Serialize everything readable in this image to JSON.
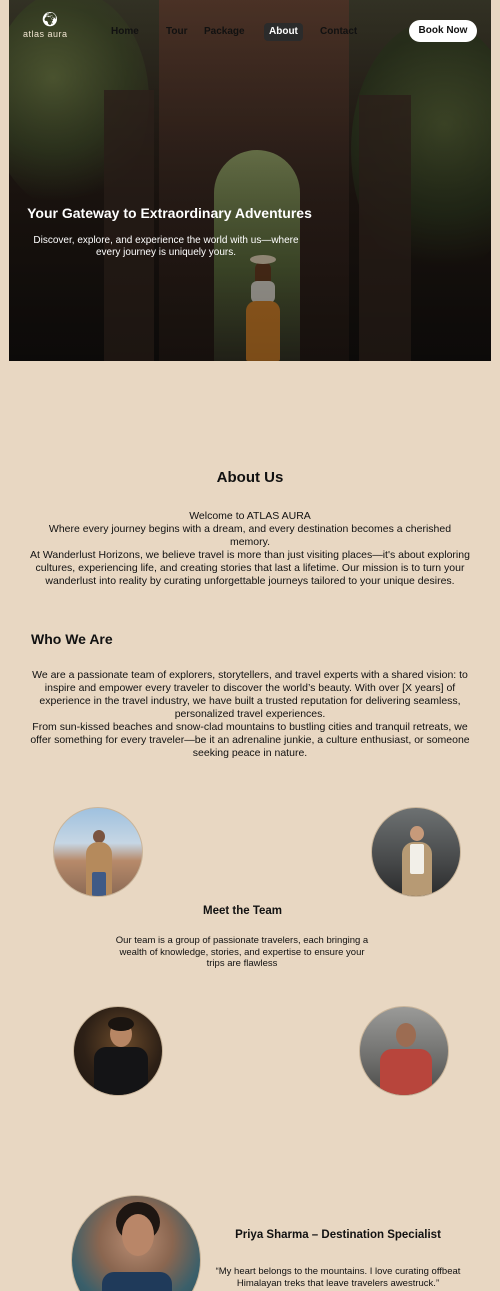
{
  "brand": {
    "name": "atlas aura"
  },
  "nav": {
    "links": [
      "Home",
      "Tour",
      "Package",
      "About",
      "Contact"
    ],
    "active": "About",
    "cta": "Book Now"
  },
  "hero": {
    "title": "Your Gateway to Extraordinary Adventures",
    "subtitle": "Discover, explore, and experience the world with us—where every journey is uniquely yours."
  },
  "about": {
    "title": "About Us",
    "paragraphs": [
      "Welcome to ATLAS AURA",
      "Where every journey begins with a dream, and every destination becomes a cherished memory.",
      "At Wanderlust Horizons, we believe travel is more than just visiting places—it's about exploring cultures, experiencing life, and creating stories that last a lifetime. Our mission is to turn your wanderlust into reality by curating unforgettable journeys tailored to your unique desires."
    ]
  },
  "who": {
    "title": "Who We Are",
    "paragraphs": [
      "We are a passionate team of explorers, storytellers, and travel experts with a shared vision: to inspire and empower every traveler to discover the world’s beauty. With over [X years] of experience in the travel industry, we have built a trusted reputation for delivering seamless, personalized travel experiences.",
      "From sun-kissed beaches and snow-clad mountains to bustling cities and tranquil retreats, we offer something for every traveler—be it an adrenaline junkie, a culture enthusiast, or someone seeking peace in nature."
    ]
  },
  "team": {
    "title": "Meet the Team",
    "description": "Our team is a group of passionate travelers, each bringing a wealth of knowledge, stories, and expertise to ensure your trips are flawless"
  },
  "featured_member": {
    "title": "Priya Sharma – Destination Specialist",
    "quote": "“My heart belongs to the mountains. I love curating offbeat Himalayan treks that leave travelers awestruck.”"
  },
  "colors": {
    "background": "#e8d7c2",
    "active_nav_bg": "#2b2b2b",
    "cta_bg": "#ffffff"
  }
}
